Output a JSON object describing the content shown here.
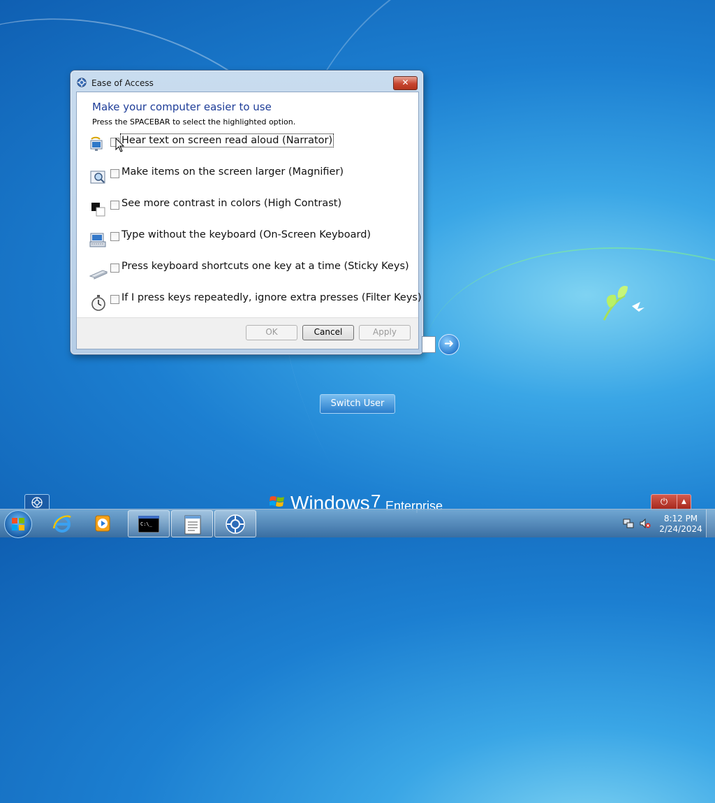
{
  "dialog": {
    "title": "Ease of Access",
    "heading": "Make your computer easier to use",
    "instruction": "Press the SPACEBAR to select the highlighted option.",
    "options": [
      {
        "label": "Hear text on screen read aloud (Narrator)",
        "checked": false,
        "icon": "narrator-icon",
        "focused": true
      },
      {
        "label": "Make items on the screen larger (Magnifier)",
        "checked": false,
        "icon": "magnifier-icon"
      },
      {
        "label": "See more contrast in colors (High Contrast)",
        "checked": false,
        "icon": "high-contrast-icon"
      },
      {
        "label": "Type without the keyboard (On-Screen Keyboard)",
        "checked": false,
        "icon": "on-screen-keyboard-icon"
      },
      {
        "label": "Press keyboard shortcuts one key at a time (Sticky Keys)",
        "checked": false,
        "icon": "sticky-keys-icon"
      },
      {
        "label": "If I press keys repeatedly, ignore extra presses (Filter Keys)",
        "checked": false,
        "icon": "filter-keys-icon"
      }
    ],
    "buttons": {
      "ok": "OK",
      "cancel": "Cancel",
      "apply": "Apply"
    },
    "close_glyph": "✕"
  },
  "login": {
    "switch_user": "Switch User",
    "arrow_glyph": "➜",
    "power_glyph": "⏻",
    "power_menu_glyph": "▲"
  },
  "branding": {
    "word": "Windows",
    "version": "7",
    "edition": "Enterprise"
  },
  "taskbar": {
    "items": [
      "start-button",
      "internet-explorer",
      "media-player",
      "command-prompt",
      "notepad-app",
      "ease-of-access-app"
    ],
    "time": "8:12 PM",
    "date": "2/24/2024"
  },
  "colors": {
    "accent": "#1e3d98",
    "close": "#c7452f",
    "power": "#a3241a"
  }
}
